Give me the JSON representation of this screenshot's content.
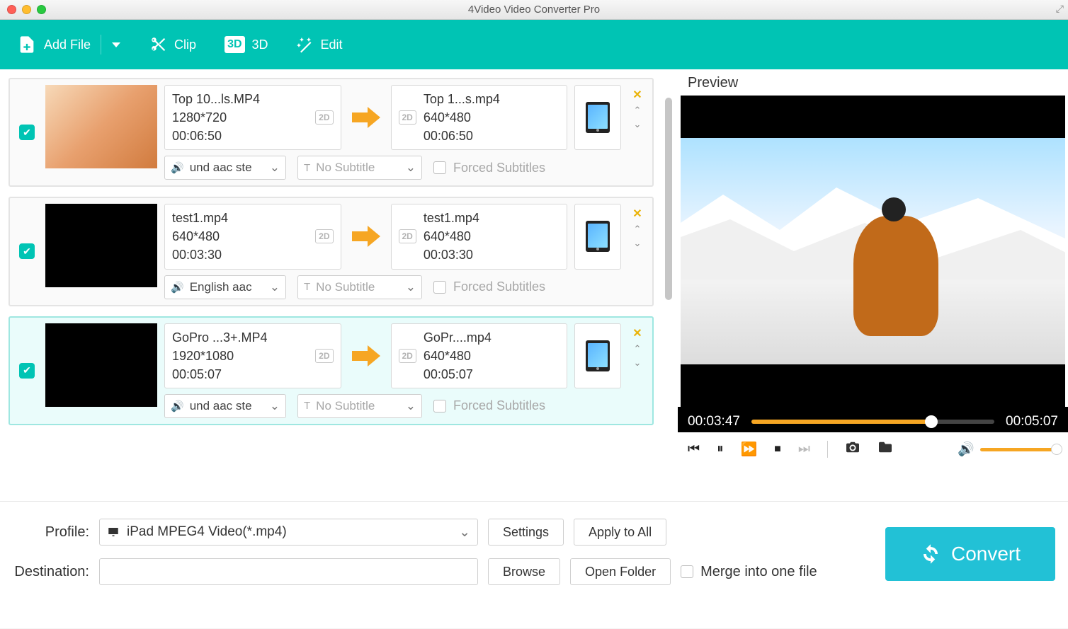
{
  "window": {
    "title": "4Video Video Converter Pro"
  },
  "toolbar": {
    "add_file": "Add File",
    "clip": "Clip",
    "three_d": "3D",
    "edit": "Edit"
  },
  "files": [
    {
      "checked": true,
      "selected": false,
      "thumbnail": "warm-scene",
      "src": {
        "name": "Top 10...ls.MP4",
        "resolution": "1280*720",
        "duration": "00:06:50",
        "badge": "2D"
      },
      "dst": {
        "name": "Top 1...s.mp4",
        "resolution": "640*480",
        "duration": "00:06:50",
        "badge": "2D"
      },
      "audio": "und aac ste",
      "subtitle": "No Subtitle",
      "forced_label": "Forced Subtitles"
    },
    {
      "checked": true,
      "selected": false,
      "thumbnail": "green-title",
      "src": {
        "name": "test1.mp4",
        "resolution": "640*480",
        "duration": "00:03:30",
        "badge": "2D"
      },
      "dst": {
        "name": "test1.mp4",
        "resolution": "640*480",
        "duration": "00:03:30",
        "badge": "2D"
      },
      "audio": "English aac",
      "subtitle": "No Subtitle",
      "forced_label": "Forced Subtitles"
    },
    {
      "checked": true,
      "selected": true,
      "thumbnail": "black",
      "src": {
        "name": "GoPro ...3+.MP4",
        "resolution": "1920*1080",
        "duration": "00:05:07",
        "badge": "2D"
      },
      "dst": {
        "name": "GoPr....mp4",
        "resolution": "640*480",
        "duration": "00:05:07",
        "badge": "2D"
      },
      "audio": "und aac ste",
      "subtitle": "No Subtitle",
      "forced_label": "Forced Subtitles"
    }
  ],
  "preview": {
    "title": "Preview",
    "current_time": "00:03:47",
    "total_time": "00:05:07",
    "progress_pct": 74
  },
  "bottom": {
    "profile_label": "Profile:",
    "profile_value": "iPad MPEG4 Video(*.mp4)",
    "settings": "Settings",
    "apply_all": "Apply to All",
    "destination_label": "Destination:",
    "destination_value": "",
    "browse": "Browse",
    "open_folder": "Open Folder",
    "merge_label": "Merge into one file",
    "convert": "Convert"
  }
}
